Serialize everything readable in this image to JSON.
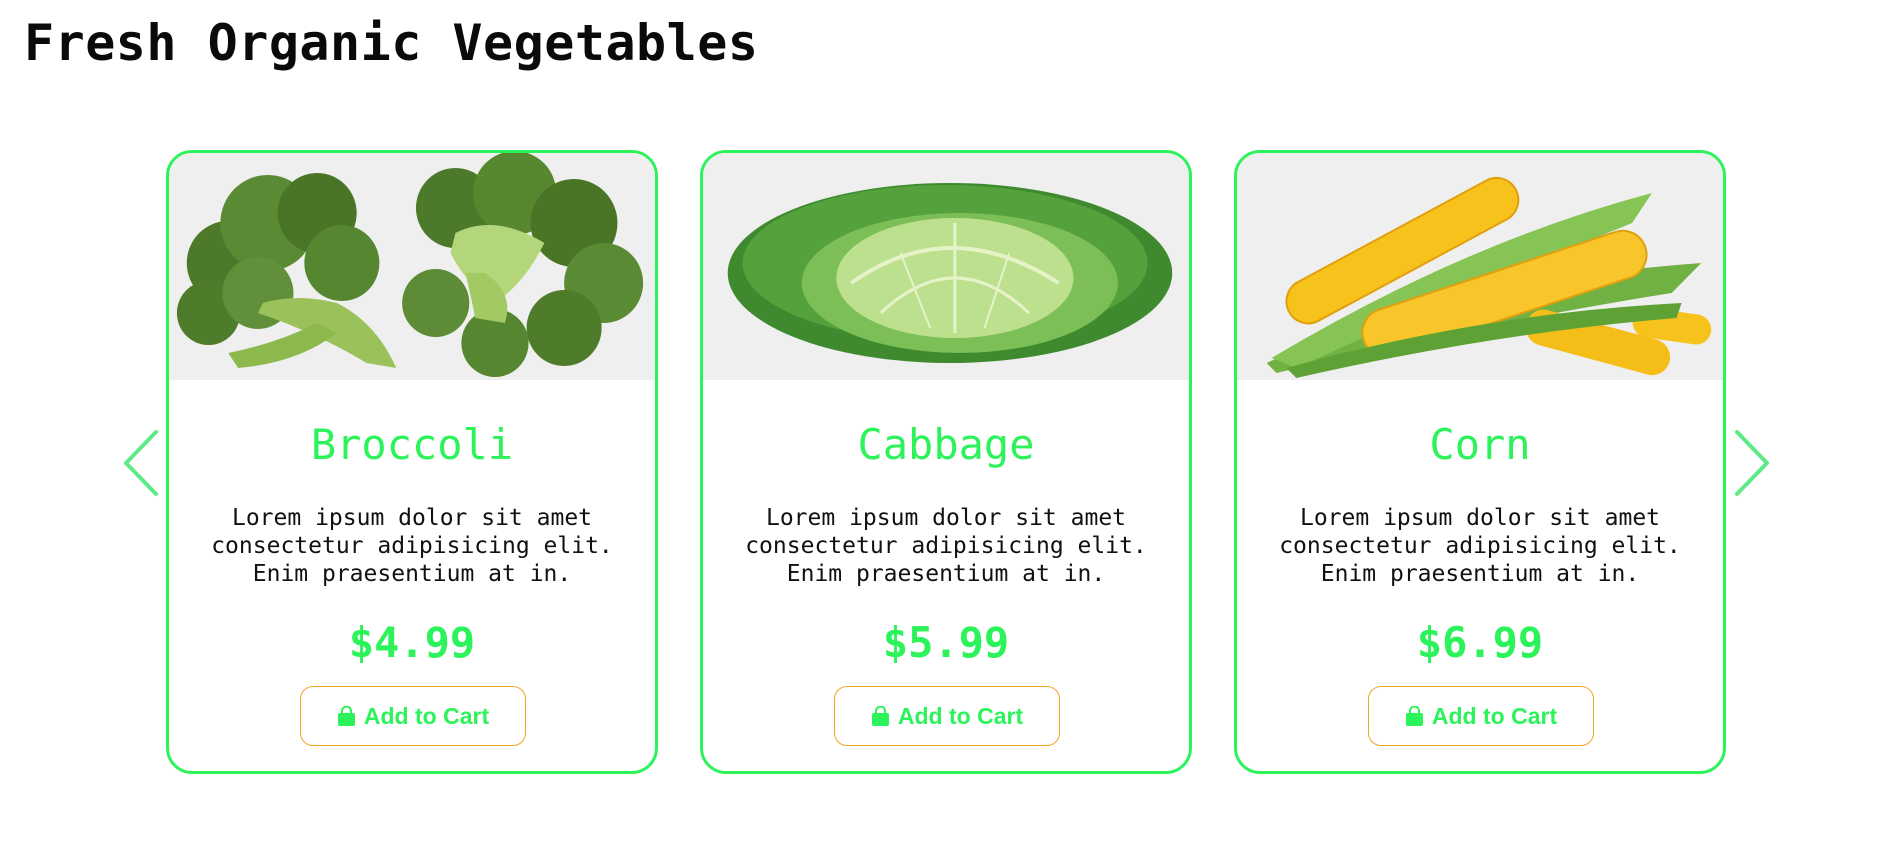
{
  "page": {
    "title": "Fresh Organic Vegetables"
  },
  "theme": {
    "accent": "#2cf35a",
    "button_border": "#f5a524",
    "image_bg": "#efefef"
  },
  "products": [
    {
      "name": "Broccoli",
      "description": "Lorem ipsum dolor sit amet consectetur adipisicing elit. Enim praesentium at in.",
      "price": "$4.99",
      "button_label": "Add to Cart",
      "button_icon": "shopping-bag-icon",
      "image": "broccoli-image"
    },
    {
      "name": "Cabbage",
      "description": "Lorem ipsum dolor sit amet consectetur adipisicing elit. Enim praesentium at in.",
      "price": "$5.99",
      "button_label": "Add to Cart",
      "button_icon": "shopping-bag-icon",
      "image": "cabbage-image"
    },
    {
      "name": "Corn",
      "description": "Lorem ipsum dolor sit amet consectetur adipisicing elit. Enim praesentium at in.",
      "price": "$6.99",
      "button_label": "Add to Cart",
      "button_icon": "shopping-bag-icon",
      "image": "corn-image"
    }
  ],
  "carousel": {
    "prev_icon": "chevron-left-icon",
    "next_icon": "chevron-right-icon"
  }
}
